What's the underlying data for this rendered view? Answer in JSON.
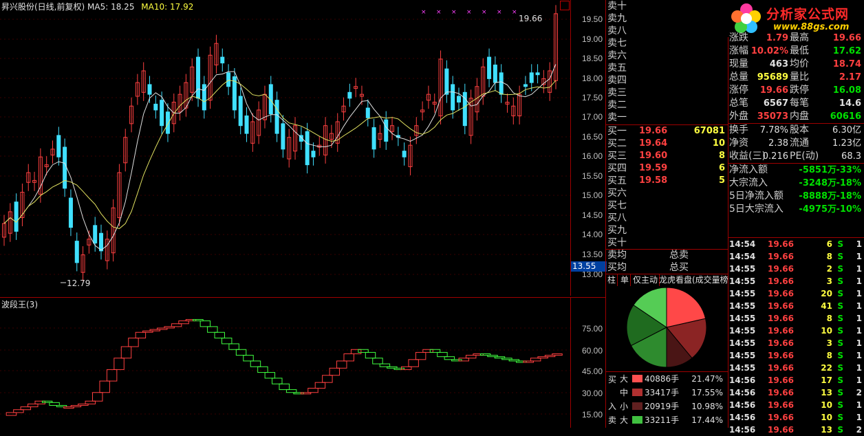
{
  "header": {
    "title": "昇兴股份(日线,前复权)",
    "ma5_label": "MA5:",
    "ma5": "18.25",
    "ma10_label": "MA10:",
    "ma10": "17.92"
  },
  "price_axis": {
    "ticks": [
      "19.50",
      "19.00",
      "18.50",
      "18.00",
      "17.50",
      "17.00",
      "16.50",
      "16.00",
      "15.50",
      "15.00",
      "14.50",
      "14.00",
      "13.50",
      "13.00"
    ],
    "current_label": "13.55",
    "high_label": "19.66",
    "low_label": "12.79"
  },
  "indicator": {
    "title": "波段王(3)",
    "ticks": [
      "75.00",
      "60.00",
      "45.00",
      "30.00",
      "15.00"
    ]
  },
  "order_book": {
    "sell_levels": [
      "卖十",
      "卖九",
      "卖八",
      "卖七",
      "卖六",
      "卖五",
      "卖四",
      "卖三",
      "卖二",
      "卖一"
    ],
    "buy_levels": [
      {
        "label": "买一",
        "price": "19.66",
        "vol": "67081"
      },
      {
        "label": "买二",
        "price": "19.64",
        "vol": "10"
      },
      {
        "label": "买三",
        "price": "19.60",
        "vol": "8"
      },
      {
        "label": "买四",
        "price": "19.59",
        "vol": "6"
      },
      {
        "label": "买五",
        "price": "19.58",
        "vol": "5"
      },
      {
        "label": "买六",
        "price": "",
        "vol": ""
      },
      {
        "label": "买七",
        "price": "",
        "vol": ""
      },
      {
        "label": "买八",
        "price": "",
        "vol": ""
      },
      {
        "label": "买九",
        "price": "",
        "vol": ""
      },
      {
        "label": "买十",
        "price": "",
        "vol": ""
      }
    ],
    "avg_sell": "卖均",
    "avg_buy": "买均",
    "total_sell": "总卖",
    "total_buy": "总买",
    "tabs": [
      "柱",
      "单",
      "仅主动",
      "龙虎看盘(成交量榜"
    ]
  },
  "logo": {
    "text": "分析家公式网",
    "url": "www.88gs.com"
  },
  "quote": {
    "rows": [
      {
        "l1": "涨跌",
        "v1": "1.79",
        "c1": "red",
        "l2": "最高",
        "v2": "19.66",
        "c2": "red"
      },
      {
        "l1": "涨幅",
        "v1": "10.02%",
        "c1": "red",
        "l2": "最低",
        "v2": "17.62",
        "c2": "green"
      },
      {
        "l1": "现量",
        "v1": "463",
        "c1": "white",
        "l2": "均价",
        "v2": "18.74",
        "c2": "red"
      },
      {
        "l1": "总量",
        "v1": "95689",
        "c1": "yellow",
        "l2": "量比",
        "v2": "2.17",
        "c2": "red"
      },
      {
        "l1": "涨停",
        "v1": "19.66",
        "c1": "red",
        "l2": "跌停",
        "v2": "16.08",
        "c2": "green"
      },
      {
        "l1": "总笔",
        "v1": "6567",
        "c1": "white",
        "l2": "每笔",
        "v2": "14.6",
        "c2": "white"
      },
      {
        "l1": "外盘",
        "v1": "35073",
        "c1": "red",
        "l2": "内盘",
        "v2": "60616",
        "c2": "green"
      }
    ],
    "rows2": [
      {
        "l1": "换手",
        "v1": "7.78%",
        "l2": "股本",
        "v2": "6.30亿"
      },
      {
        "l1": "净资",
        "v1": "2.38",
        "l2": "流通",
        "v2": "1.23亿"
      },
      {
        "l1": "收益(三)",
        "v1": "0.216",
        "l2": "PE(动)",
        "v2": "68.3"
      }
    ],
    "flows": [
      {
        "label": "净流入额",
        "val": "-5851万",
        "pct": "-33%"
      },
      {
        "label": "大宗流入",
        "val": "-3248万",
        "pct": "-18%"
      },
      {
        "label": "5日净流入额",
        "val": "-8888万",
        "pct": "-18%"
      },
      {
        "label": "5日大宗流入",
        "val": "-4975万",
        "pct": "-10%"
      }
    ]
  },
  "ticks": [
    {
      "t": "14:54",
      "p": "19.66",
      "v": "6",
      "s": "S",
      "n": "1"
    },
    {
      "t": "14:54",
      "p": "19.66",
      "v": "8",
      "s": "S",
      "n": "1"
    },
    {
      "t": "14:55",
      "p": "19.66",
      "v": "2",
      "s": "S",
      "n": "1"
    },
    {
      "t": "14:55",
      "p": "19.66",
      "v": "3",
      "s": "S",
      "n": "1"
    },
    {
      "t": "14:55",
      "p": "19.66",
      "v": "20",
      "s": "S",
      "n": "1"
    },
    {
      "t": "14:55",
      "p": "19.66",
      "v": "41",
      "s": "S",
      "n": "1"
    },
    {
      "t": "14:55",
      "p": "19.66",
      "v": "8",
      "s": "S",
      "n": "1"
    },
    {
      "t": "14:55",
      "p": "19.66",
      "v": "10",
      "s": "S",
      "n": "1"
    },
    {
      "t": "14:55",
      "p": "19.66",
      "v": "3",
      "s": "S",
      "n": "1"
    },
    {
      "t": "14:55",
      "p": "19.66",
      "v": "8",
      "s": "S",
      "n": "1"
    },
    {
      "t": "14:55",
      "p": "19.66",
      "v": "22",
      "s": "S",
      "n": "1"
    },
    {
      "t": "14:56",
      "p": "19.66",
      "v": "17",
      "s": "S",
      "n": "1"
    },
    {
      "t": "14:56",
      "p": "19.66",
      "v": "13",
      "s": "S",
      "n": "2"
    },
    {
      "t": "14:56",
      "p": "19.66",
      "v": "10",
      "s": "S",
      "n": "1"
    },
    {
      "t": "14:56",
      "p": "19.66",
      "v": "10",
      "s": "S",
      "n": "1"
    },
    {
      "t": "14:56",
      "p": "19.66",
      "v": "13",
      "s": "S",
      "n": "2"
    }
  ],
  "money_flow": {
    "buy_label": "买",
    "in_label": "入",
    "sell_label": "卖",
    "rows": [
      {
        "size": "大",
        "vol": "40886手",
        "pct": "21.47%",
        "color": "#ff5050"
      },
      {
        "size": "中",
        "vol": "33417手",
        "pct": "17.55%",
        "color": "#b03030"
      },
      {
        "size": "小",
        "vol": "20919手",
        "pct": "10.98%",
        "color": "#602020"
      },
      {
        "size": "大",
        "vol": "33211手",
        "pct": "17.44%",
        "color": "#40c040"
      }
    ],
    "pie": [
      21.47,
      17.55,
      10.98,
      17.44,
      17.0,
      15.56
    ],
    "pie_colors": [
      "#ff4848",
      "#8b2424",
      "#4a1515",
      "#2e8b2e",
      "#1f6b1f",
      "#55cc55"
    ]
  },
  "colors": {
    "up": "#ff4040",
    "down": "#40e0ff",
    "frame": "#a00000"
  }
}
